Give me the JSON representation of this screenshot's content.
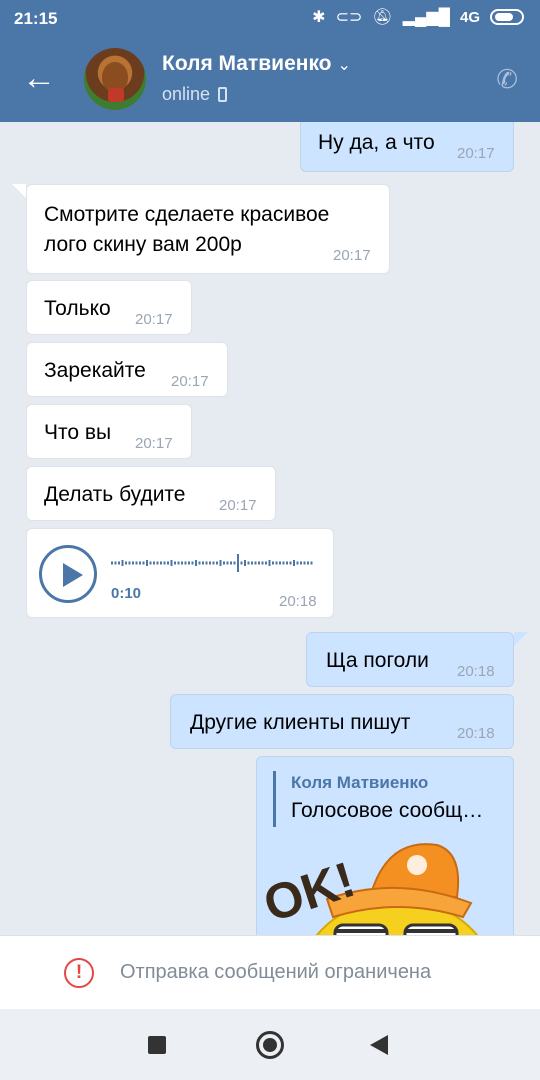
{
  "status_bar": {
    "time": "21:15",
    "network": "4G",
    "icons": [
      "bluetooth-icon",
      "vpn-icon",
      "mute-icon",
      "signal-icon",
      "battery-icon"
    ]
  },
  "header": {
    "contact_name": "Коля Матвиенко",
    "presence": "online",
    "icons": [
      "back-arrow-icon",
      "chevron-down-icon",
      "mobile-icon",
      "phone-icon"
    ]
  },
  "messages": [
    {
      "direction": "out",
      "text": "Ну да, а что",
      "time": "20:17"
    },
    {
      "direction": "in",
      "text": "Смотрите сделаете красивое лого скину вам 200р",
      "line1": "Смотрите сделаете красивое",
      "line2": "лого скину вам 200р",
      "time": "20:17"
    },
    {
      "direction": "in",
      "text": "Только",
      "time": "20:17"
    },
    {
      "direction": "in",
      "text": "Зарекайте",
      "time": "20:17"
    },
    {
      "direction": "in",
      "text": "Что вы",
      "time": "20:17"
    },
    {
      "direction": "in",
      "text": "Делать будите",
      "time": "20:17"
    },
    {
      "direction": "in",
      "type": "voice",
      "duration": "0:10",
      "time": "20:18"
    },
    {
      "direction": "out",
      "text": "Ща поголи",
      "time": "20:18"
    },
    {
      "direction": "out",
      "text": "Другие клиенты пишут",
      "time": "20:18"
    },
    {
      "direction": "out",
      "type": "forward",
      "forward_author": "Коля Матвиенко",
      "forward_text": "Голосовое сообщ…",
      "sticker": "OK!"
    }
  ],
  "footer": {
    "restriction_text": "Отправка сообщений ограничена"
  },
  "colors": {
    "header": "#4a76a8",
    "incoming": "#ffffff",
    "outgoing": "#cce4ff",
    "accent": "#4a76a8",
    "warning": "#e64646"
  }
}
